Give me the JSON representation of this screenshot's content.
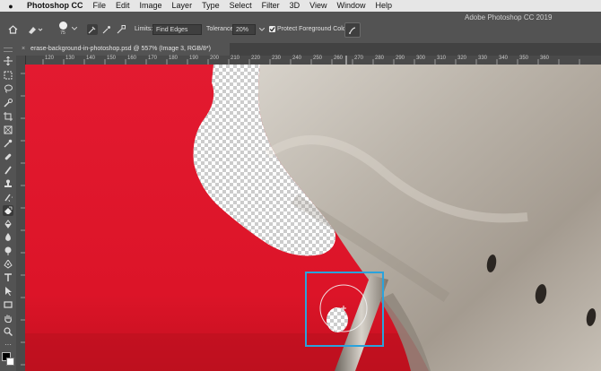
{
  "menubar": {
    "app_name": "Photoshop CC",
    "items": [
      "File",
      "Edit",
      "Image",
      "Layer",
      "Type",
      "Select",
      "Filter",
      "3D",
      "View",
      "Window",
      "Help"
    ]
  },
  "window": {
    "app_title": "Adobe Photoshop CC 2019"
  },
  "options_bar": {
    "brush_size": "75",
    "limits_label": "Limits:",
    "limits_value": "Find Edges",
    "tolerance_label": "Tolerance:",
    "tolerance_value": "20%",
    "protect_label": "Protect Foreground Color",
    "protect_checked": true
  },
  "document": {
    "tab_title": "erase-background-in-photoshop.psd @ 557% (Image 3, RGB/8*)",
    "tab_close": "×"
  },
  "ruler": {
    "h_labels": [
      "120",
      "130",
      "140",
      "150",
      "160",
      "170",
      "180",
      "190",
      "200",
      "210",
      "220",
      "230",
      "240",
      "250",
      "260",
      "270",
      "280",
      "290",
      "300",
      "310",
      "320",
      "330",
      "340",
      "350",
      "360"
    ]
  },
  "tools": [
    "move-tool",
    "marquee-tool",
    "lasso-tool",
    "quick-select-tool",
    "crop-tool",
    "frame-tool",
    "eyedropper-tool",
    "healing-brush-tool",
    "brush-tool",
    "clone-stamp-tool",
    "history-brush-tool",
    "background-eraser-tool",
    "gradient-tool",
    "blur-tool",
    "dodge-tool",
    "pen-tool",
    "type-tool",
    "path-select-tool",
    "rectangle-tool",
    "hand-tool",
    "zoom-tool",
    "more-tools"
  ],
  "colors": {
    "canvas_red": "#e41930",
    "metal": "#bdb6ad",
    "selection_box": "#2aa3dc",
    "ui_panel": "#535353"
  }
}
